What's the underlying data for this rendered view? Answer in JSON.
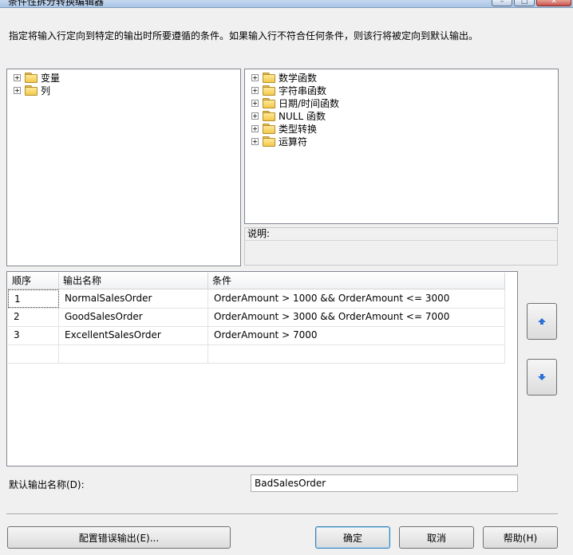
{
  "window": {
    "title": "条件性拆分转换编辑器"
  },
  "description": "指定将输入行定向到特定的输出时所要遵循的条件。如果输入行不符合任何条件，则该行将被定向到默认输出。",
  "left_tree": [
    {
      "label": "变量"
    },
    {
      "label": "列"
    }
  ],
  "right_tree": [
    {
      "label": "数学函数"
    },
    {
      "label": "字符串函数"
    },
    {
      "label": "日期/时间函数"
    },
    {
      "label": "NULL 函数"
    },
    {
      "label": "类型转换"
    },
    {
      "label": "运算符"
    }
  ],
  "description_panel": {
    "label": "说明:"
  },
  "grid": {
    "columns": [
      "顺序",
      "输出名称",
      "条件"
    ],
    "rows": [
      {
        "order": "1",
        "name": "NormalSalesOrder",
        "condition": "OrderAmount > 1000 && OrderAmount <= 3000"
      },
      {
        "order": "2",
        "name": "GoodSalesOrder",
        "condition": "OrderAmount > 3000 && OrderAmount <= 7000"
      },
      {
        "order": "3",
        "name": "ExcellentSalesOrder",
        "condition": "OrderAmount > 7000"
      }
    ]
  },
  "default_output": {
    "label": "默认输出名称(D):",
    "value": "BadSalesOrder"
  },
  "buttons": {
    "configure_error": "配置错误输出(E)...",
    "ok": "确定",
    "cancel": "取消",
    "help": "帮助(H)"
  },
  "icons": {
    "move_up": "arrow-up-icon",
    "move_down": "arrow-down-icon"
  },
  "colors": {
    "arrow": "#2a6fd6",
    "window_bg": "#f0f0f0"
  }
}
